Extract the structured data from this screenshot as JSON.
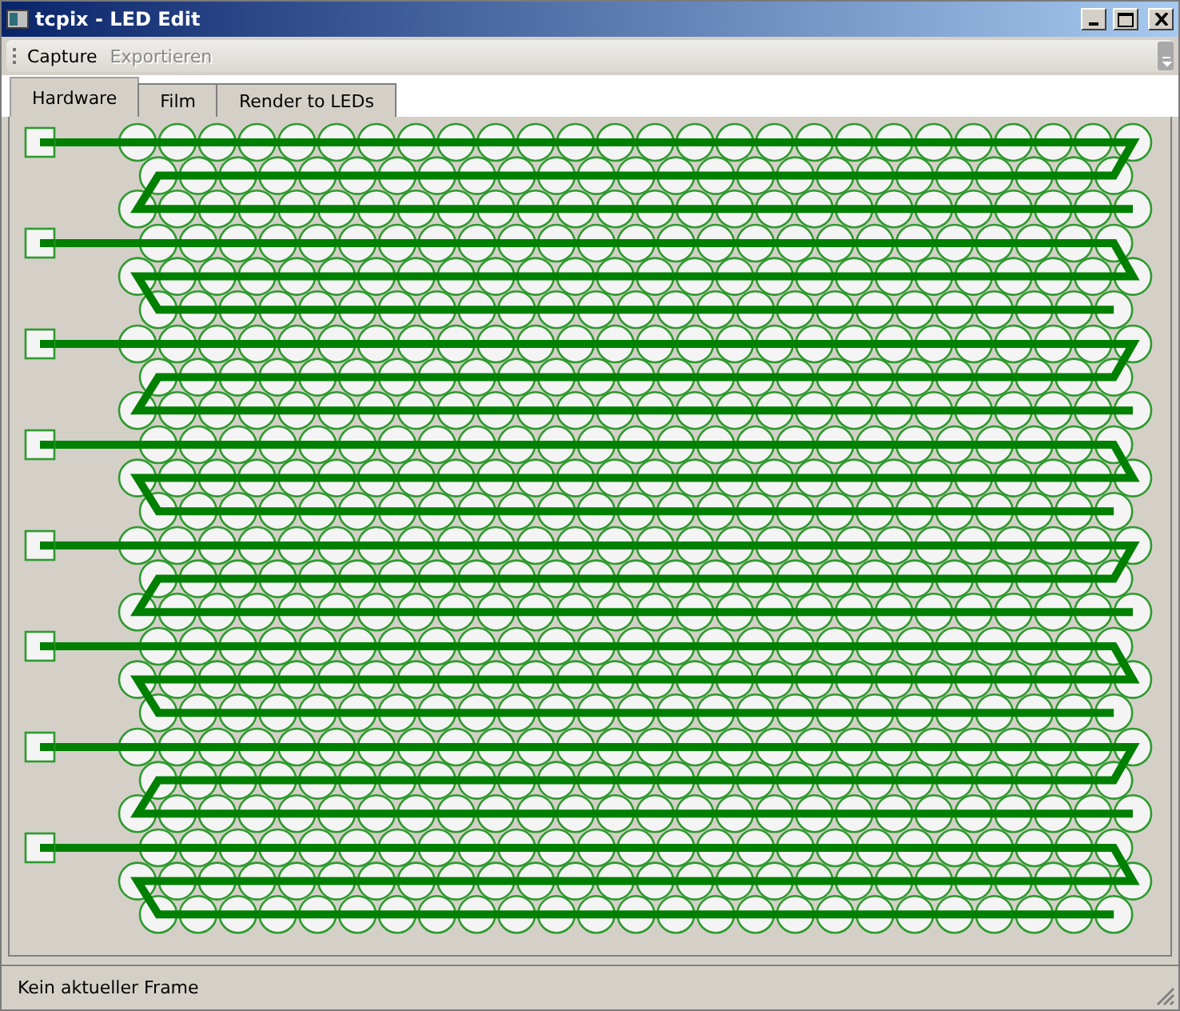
{
  "window": {
    "title": "tcpix - LED Edit"
  },
  "menu": [
    {
      "label": "Capture",
      "disabled": false
    },
    {
      "label": "Exportieren",
      "disabled": true
    }
  ],
  "tabs": [
    {
      "label": "Hardware",
      "selected": true
    },
    {
      "label": "Film",
      "selected": false
    },
    {
      "label": "Render to LEDs",
      "selected": false
    }
  ],
  "status_bar": "Kein aktueller Frame"
}
